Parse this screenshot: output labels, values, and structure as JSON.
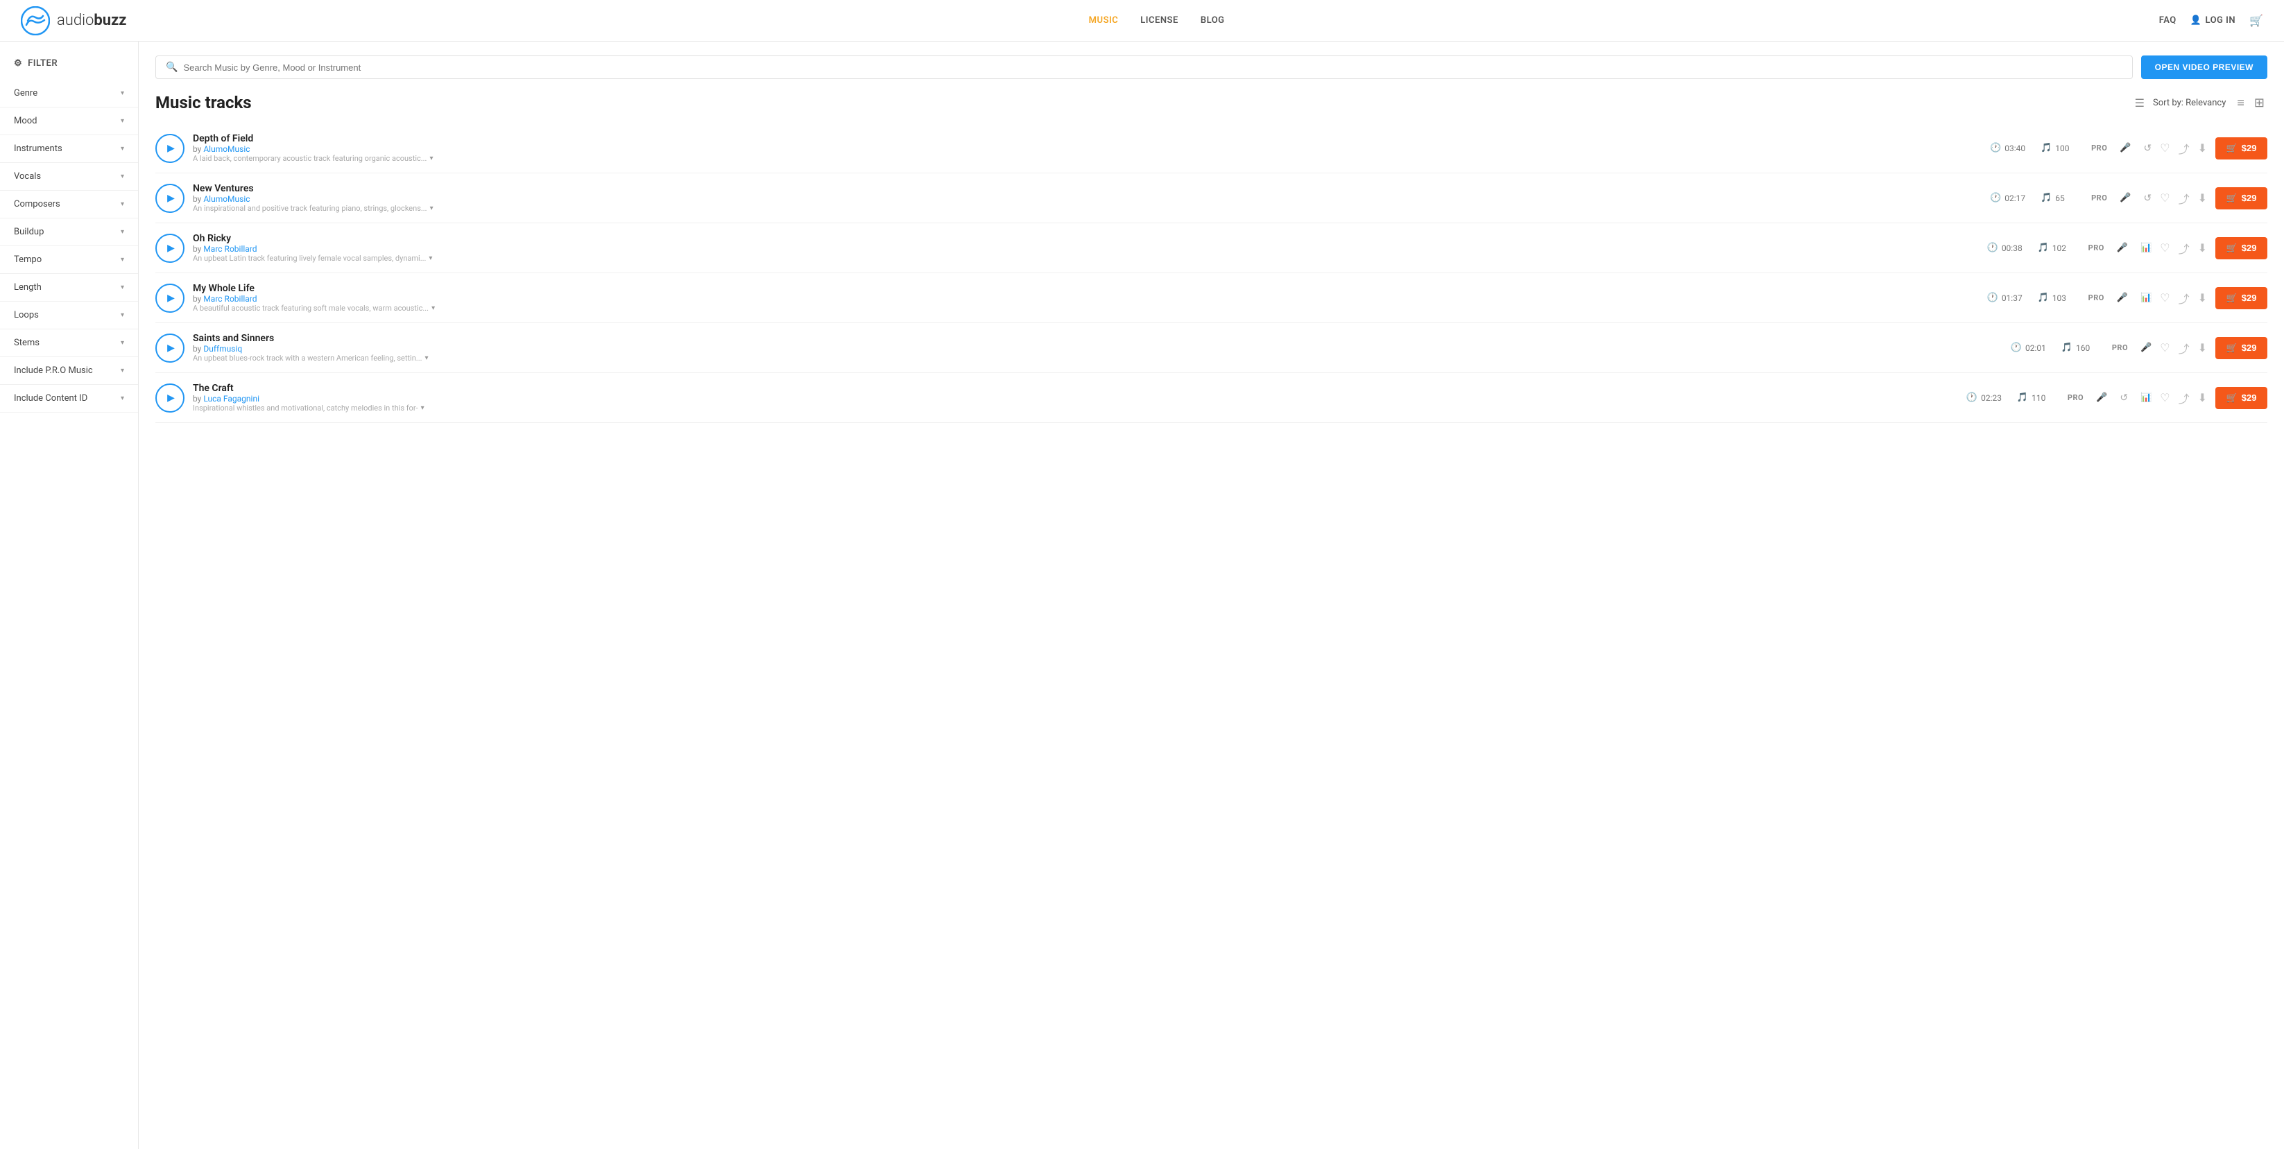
{
  "topbar": {
    "logo_text_light": "audio",
    "logo_text_bold": "buzz",
    "nav_links": [
      {
        "label": "MUSIC",
        "active": true
      },
      {
        "label": "LICENSE",
        "active": false
      },
      {
        "label": "BLOG",
        "active": false
      }
    ],
    "nav_right": [
      {
        "label": "FAQ"
      },
      {
        "label": "LOG IN"
      }
    ]
  },
  "sidebar": {
    "filter_label": "FILTER",
    "items": [
      {
        "label": "Genre"
      },
      {
        "label": "Mood"
      },
      {
        "label": "Instruments"
      },
      {
        "label": "Vocals"
      },
      {
        "label": "Composers"
      },
      {
        "label": "Buildup"
      },
      {
        "label": "Tempo"
      },
      {
        "label": "Length"
      },
      {
        "label": "Loops"
      },
      {
        "label": "Stems"
      },
      {
        "label": "Include P.R.O Music"
      },
      {
        "label": "Include Content ID"
      }
    ]
  },
  "search": {
    "placeholder": "Search Music by Genre, Mood or Instrument"
  },
  "open_video_btn_label": "OPEN VIDEO PREVIEW",
  "tracks_title": "Music tracks",
  "sort_label": "Sort by: Relevancy",
  "tracks": [
    {
      "title": "Depth of Field",
      "composer": "AlumoMusic",
      "duration": "03:40",
      "bpm": "100",
      "pro": true,
      "vocals": false,
      "stems": false,
      "loop": true,
      "desc": "A laid back, contemporary acoustic track featuring organic acoustic...",
      "price": "$29"
    },
    {
      "title": "New Ventures",
      "composer": "AlumoMusic",
      "duration": "02:17",
      "bpm": "65",
      "pro": true,
      "vocals": false,
      "stems": false,
      "loop": true,
      "desc": "An inspirational and positive track featuring piano, strings, glockens...",
      "price": "$29"
    },
    {
      "title": "Oh Ricky",
      "composer": "Marc Robillard",
      "duration": "00:38",
      "bpm": "102",
      "pro": true,
      "vocals": true,
      "stems": true,
      "loop": false,
      "desc": "An upbeat Latin track featuring lively female vocal samples, dynami...",
      "price": "$29"
    },
    {
      "title": "My Whole Life",
      "composer": "Marc Robillard",
      "duration": "01:37",
      "bpm": "103",
      "pro": true,
      "vocals": true,
      "stems": true,
      "loop": false,
      "desc": "A beautiful acoustic track featuring soft male vocals, warm acoustic...",
      "price": "$29"
    },
    {
      "title": "Saints and Sinners",
      "composer": "Duffmusiq",
      "duration": "02:01",
      "bpm": "160",
      "pro": true,
      "vocals": true,
      "stems": false,
      "loop": false,
      "desc": "An upbeat blues-rock track with a western American feeling, settin...",
      "price": "$29"
    },
    {
      "title": "The Craft",
      "composer": "Luca Fagagnini",
      "duration": "02:23",
      "bpm": "110",
      "pro": true,
      "vocals": false,
      "stems": true,
      "loop": true,
      "desc": "Inspirational whistles and motivational, catchy melodies in this for-",
      "price": "$29"
    }
  ]
}
